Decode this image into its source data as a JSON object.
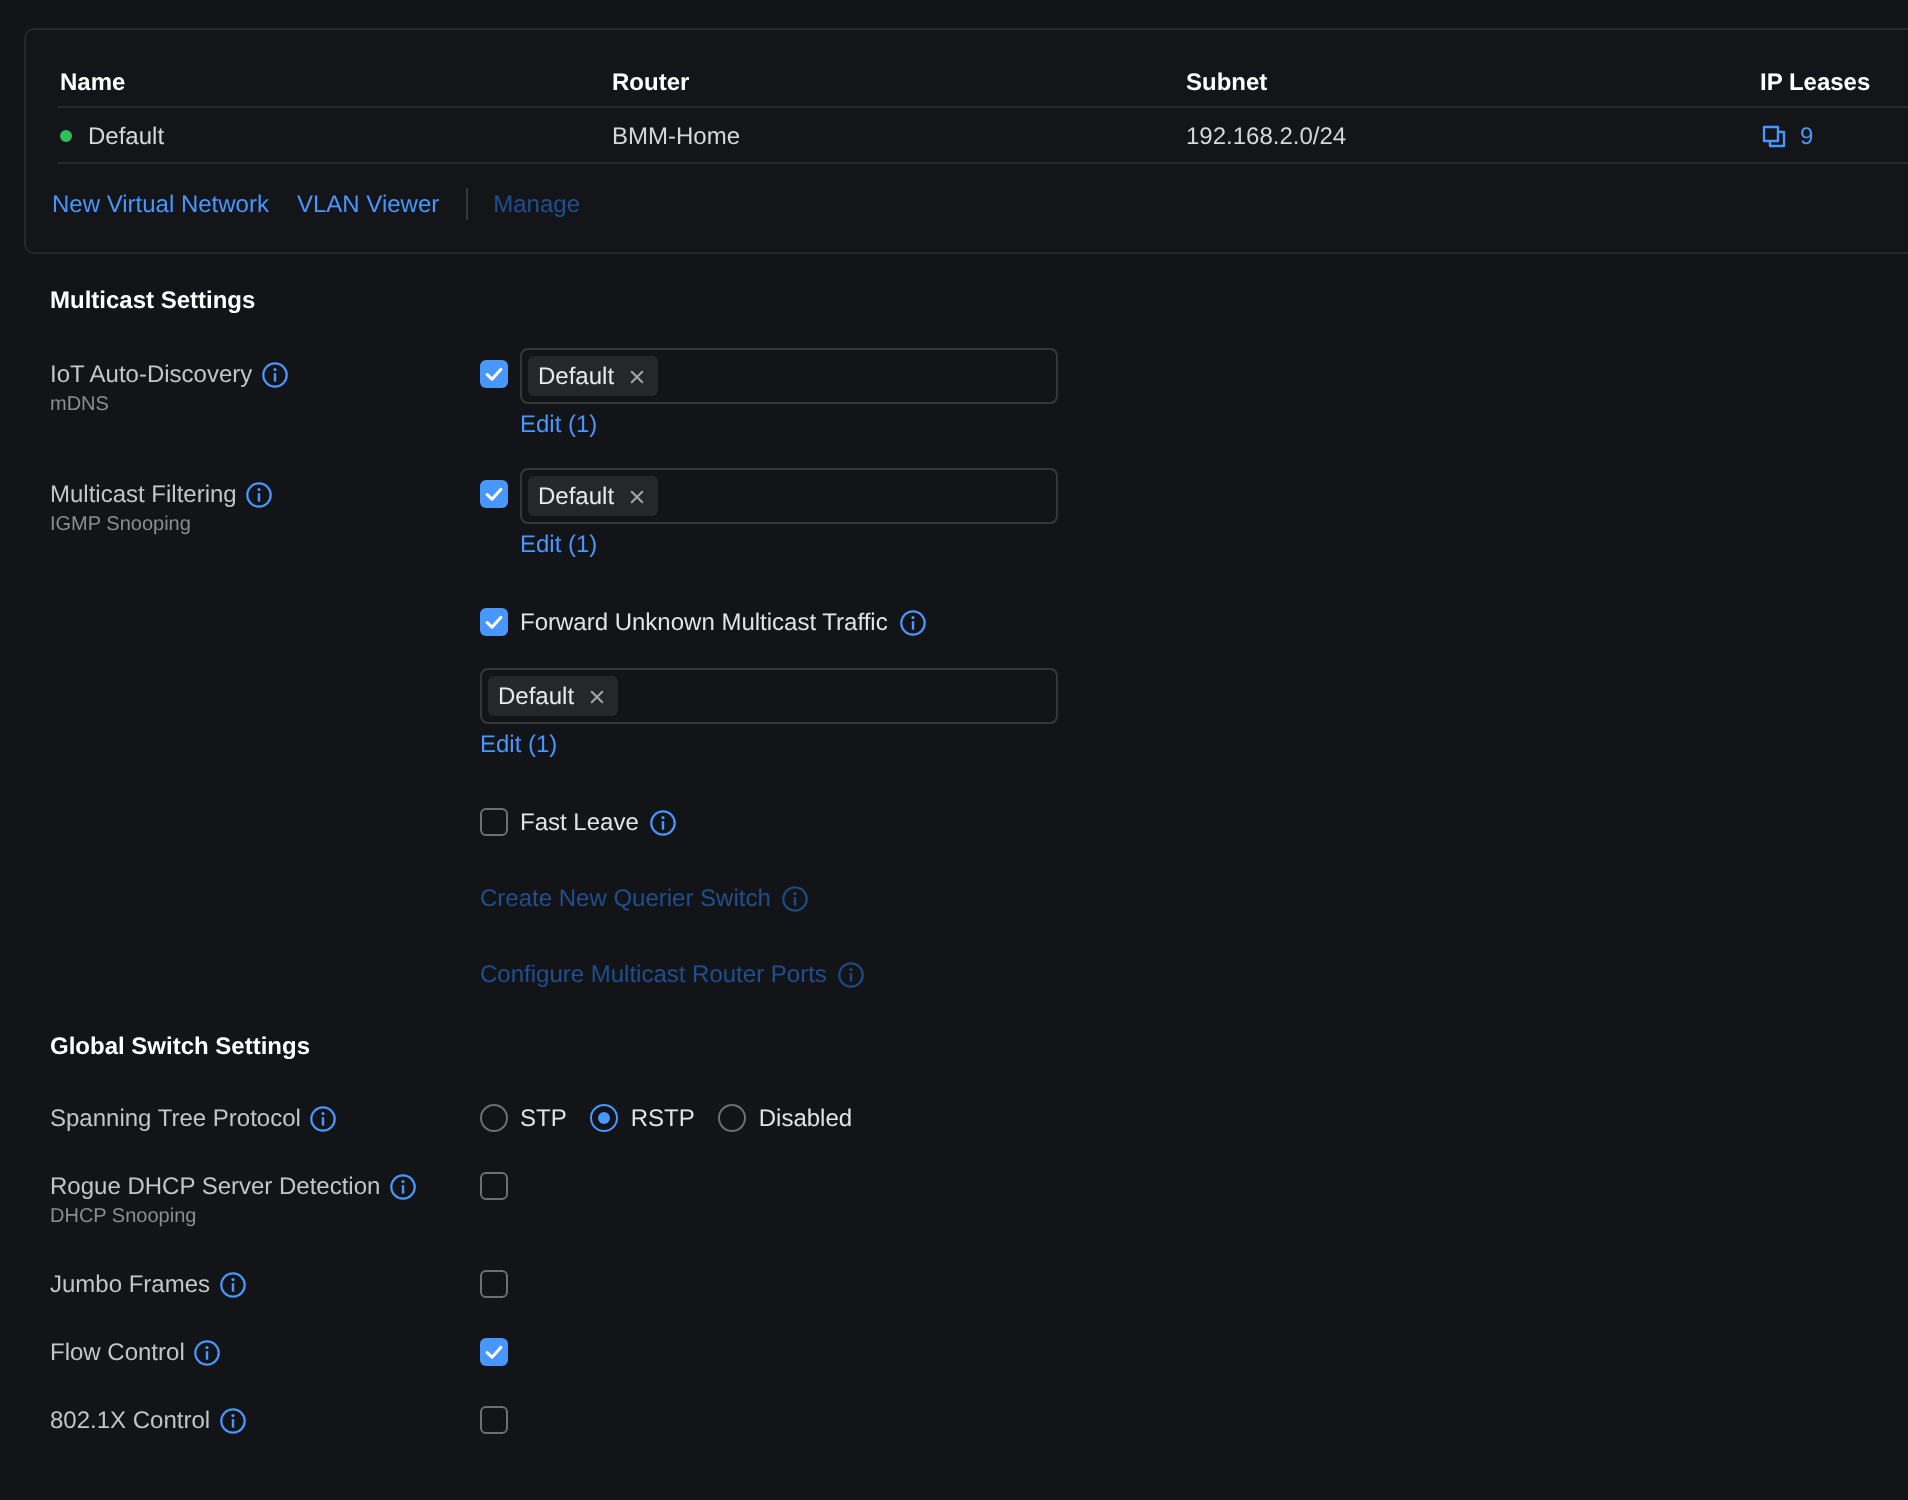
{
  "networks_table": {
    "columns": [
      "Name",
      "Router",
      "Subnet",
      "IP Leases"
    ],
    "rows": [
      {
        "name": "Default",
        "color": "#2fbf5b",
        "router": "BMM-Home",
        "subnet": "192.168.2.0/24",
        "ip_leases": "9"
      }
    ]
  },
  "network_actions": [
    {
      "items": [
        {
          "label": "New Virtual Network",
          "disabled": false
        },
        {
          "label": "VLAN Viewer",
          "disabled": false
        }
      ]
    },
    {
      "items": [
        {
          "label": "Manage",
          "disabled": true
        }
      ]
    }
  ],
  "multicast_settings": {
    "title": "Multicast Settings",
    "rows": [
      {
        "kind": "checkbox-tags",
        "label": "IoT Auto-Discovery",
        "sublabel": "mDNS",
        "checked": true,
        "tags": [
          "Default"
        ],
        "edit": "Edit (1)"
      },
      {
        "kind": "checkbox-tags",
        "label": "Multicast Filtering",
        "sublabel": "IGMP Snooping",
        "checked": true,
        "tags": [
          "Default"
        ],
        "edit": "Edit (1)"
      },
      {
        "kind": "option",
        "label": "Forward Unknown Multicast Traffic",
        "checked": true,
        "tags": [
          "Default"
        ],
        "edit": "Edit (1)"
      },
      {
        "kind": "option",
        "label": "Fast Leave",
        "checked": false
      },
      {
        "kind": "link",
        "label": "Create New Querier Switch",
        "disabled": true
      },
      {
        "kind": "link",
        "label": "Configure Multicast Router Ports",
        "disabled": true
      }
    ]
  },
  "global_switch_settings": {
    "title": "Global Switch Settings",
    "rows": [
      {
        "kind": "radio",
        "label": "Spanning Tree Protocol",
        "options": [
          {
            "label": "STP",
            "selected": false
          },
          {
            "label": "RSTP",
            "selected": true
          },
          {
            "label": "Disabled",
            "selected": false
          }
        ]
      },
      {
        "kind": "checkbox",
        "label": "Rogue DHCP Server Detection",
        "sublabel": "DHCP Snooping",
        "checked": false
      },
      {
        "kind": "checkbox",
        "label": "Jumbo Frames",
        "checked": false
      },
      {
        "kind": "checkbox",
        "label": "Flow Control",
        "checked": true
      },
      {
        "kind": "checkbox",
        "label": "802.1X Control",
        "checked": false
      }
    ]
  }
}
